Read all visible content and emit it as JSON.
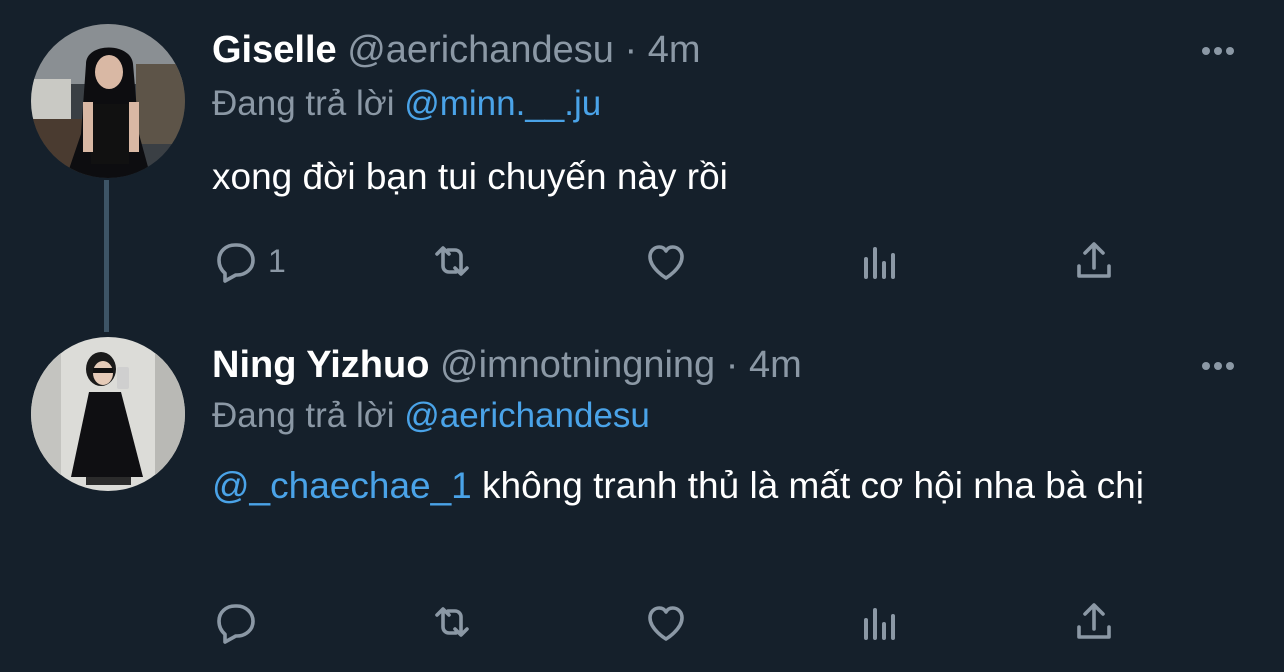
{
  "colors": {
    "background": "#15202b",
    "text": "#ffffff",
    "muted": "#8b98a5",
    "link": "#4aa3e8"
  },
  "tweets": [
    {
      "name": "Giselle",
      "handle": "@aerichandesu",
      "dot": "·",
      "time": "4m",
      "replying_label": "Đang trả lời",
      "replying_to": "@minn.__.ju",
      "mention_in_text": "",
      "text": "xong đời bạn tui chuyến này rồi",
      "reply_count": "1"
    },
    {
      "name": "Ning Yizhuo",
      "handle": "@imnotningning",
      "dot": "·",
      "time": "4m",
      "replying_label": "Đang trả lời",
      "replying_to": "@aerichandesu",
      "mention_in_text": "@_chaechae_1",
      "text": " không tranh thủ là mất cơ hội nha bà chị",
      "reply_count": ""
    }
  ],
  "icons": {
    "more": "more-horizontal-icon",
    "reply": "reply-bubble-icon",
    "retweet": "retweet-icon",
    "like": "heart-icon",
    "views": "views-bar-chart-icon",
    "share": "share-upload-icon"
  }
}
